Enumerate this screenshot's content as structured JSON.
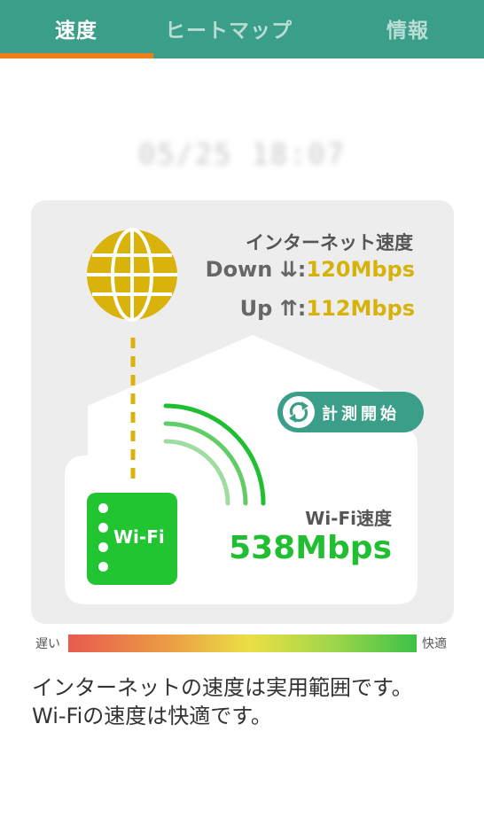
{
  "tabs": [
    {
      "label": "速度",
      "active": true
    },
    {
      "label": "ヒートマップ",
      "active": false
    },
    {
      "label": "情報",
      "active": false
    }
  ],
  "datetime": "05/25 18:07",
  "internet": {
    "title": "インターネット速度",
    "down_label": "Down ⇊:",
    "down_value": "120Mbps",
    "up_label": "Up ⇈:",
    "up_value": "112Mbps"
  },
  "measure_button": {
    "label": "計測開始",
    "icon": "refresh-icon"
  },
  "router": {
    "label": "Wi-Fi",
    "icon": "router-icon"
  },
  "wifi": {
    "title": "Wi-Fi速度",
    "value": "538Mbps"
  },
  "legend": {
    "slow": "遅い",
    "fast": "快適"
  },
  "message": {
    "line1": "インターネットの速度は実用範囲です。",
    "line2": "Wi-Fiの速度は快適です。"
  },
  "colors": {
    "header": "#3a9e89",
    "active_indicator": "#f07d1a",
    "internet_value": "#d7b20b",
    "wifi_value": "#1fbf31",
    "router": "#21c431",
    "globe": "#d9b20c"
  }
}
